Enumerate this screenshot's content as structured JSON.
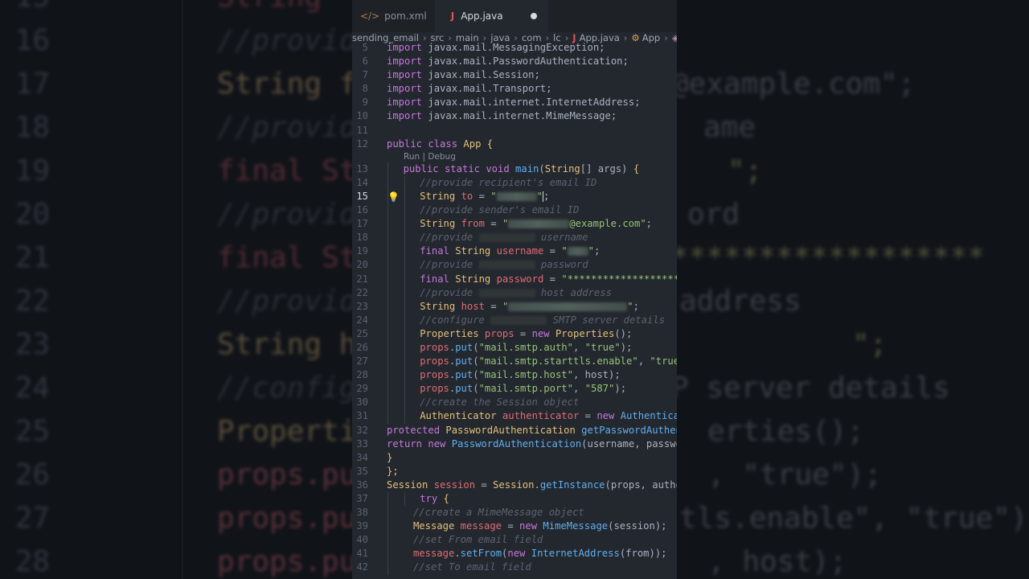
{
  "background": {
    "rows": [
      {
        "num": "15",
        "code": [
          {
            "t": "String",
            "c": "kw"
          }
        ]
      },
      {
        "num": "16",
        "code": [
          {
            "t": "//provid",
            "c": "cm"
          }
        ]
      },
      {
        "num": "17",
        "code": [
          {
            "t": "String f",
            "c": "ty"
          }
        ],
        "right": "@example.com\";"
      },
      {
        "num": "18",
        "code": [
          {
            "t": "//provid",
            "c": "cm"
          }
        ],
        "right": "ame"
      },
      {
        "num": "19",
        "code": [
          {
            "t": "final St",
            "c": "kw"
          }
        ],
        "right": "\";"
      },
      {
        "num": "20",
        "code": [
          {
            "t": "//provid",
            "c": "cm"
          }
        ],
        "right": "ord"
      },
      {
        "num": "21",
        "code": [
          {
            "t": "final St",
            "c": "kw"
          }
        ],
        "right": "******************"
      },
      {
        "num": "22",
        "code": [
          {
            "t": "//provid",
            "c": "cm"
          }
        ],
        "right": "address"
      },
      {
        "num": "23",
        "code": [
          {
            "t": "String h",
            "c": "ty"
          }
        ],
        "right": "\";"
      },
      {
        "num": "24",
        "code": [
          {
            "t": "//config",
            "c": "cm"
          }
        ],
        "right": "P server details"
      },
      {
        "num": "25",
        "code": [
          {
            "t": "Properti",
            "c": "ty"
          }
        ],
        "right": "erties();"
      },
      {
        "num": "26",
        "code": [
          {
            "t": "props.pu",
            "c": "vr"
          }
        ],
        "right": ", \"true\");"
      },
      {
        "num": "27",
        "code": [
          {
            "t": "props.pu",
            "c": "vr"
          }
        ],
        "right": "tls.enable\", \"true\")"
      },
      {
        "num": "28",
        "code": [
          {
            "t": "props.pu",
            "c": "vr"
          }
        ],
        "right": ", host);"
      }
    ]
  },
  "tabs": [
    {
      "label": "pom.xml",
      "icon": "xml-icon",
      "active": false
    },
    {
      "label": "App.java",
      "icon": "java-icon",
      "active": true,
      "modified": true
    }
  ],
  "breadcrumb": {
    "items": [
      "sending_email",
      "src",
      "main",
      "java",
      "com",
      "lc"
    ],
    "file": "App.java",
    "class": "App",
    "member": "m"
  },
  "codelens": "Run | Debug",
  "current_line": "15",
  "colors": {
    "editor_bg": "#23272e",
    "tab_bar_bg": "#1e2227",
    "keyword": "#c678dd",
    "type": "#e5c07b",
    "string": "#98c379",
    "function": "#61afef",
    "variable": "#e06c75",
    "comment": "#5c6370",
    "java_icon": "#e05252",
    "bulb": "#f0c94a"
  },
  "lines": [
    {
      "n": "5",
      "i": 0,
      "seg": [
        [
          "import ",
          "k"
        ],
        [
          "javax.mail.MessagingException;",
          "p"
        ]
      ]
    },
    {
      "n": "6",
      "i": 0,
      "seg": [
        [
          "import ",
          "k"
        ],
        [
          "javax.mail.PasswordAuthentication;",
          "p"
        ]
      ]
    },
    {
      "n": "7",
      "i": 0,
      "seg": [
        [
          "import ",
          "k"
        ],
        [
          "javax.mail.Session;",
          "p"
        ]
      ]
    },
    {
      "n": "8",
      "i": 0,
      "seg": [
        [
          "import ",
          "k"
        ],
        [
          "javax.mail.Transport;",
          "p"
        ]
      ]
    },
    {
      "n": "9",
      "i": 0,
      "seg": [
        [
          "import ",
          "k"
        ],
        [
          "javax.mail.internet.InternetAddress;",
          "p"
        ]
      ]
    },
    {
      "n": "10",
      "i": 0,
      "seg": [
        [
          "import ",
          "k"
        ],
        [
          "javax.mail.internet.MimeMessage;",
          "p"
        ]
      ]
    },
    {
      "n": "11",
      "i": 0,
      "seg": []
    },
    {
      "n": "12",
      "i": 0,
      "seg": [
        [
          "public ",
          "k"
        ],
        [
          "class ",
          "k"
        ],
        [
          "App",
          "t"
        ],
        [
          " {",
          "b"
        ]
      ]
    },
    {
      "n": "13",
      "i": 1,
      "lens": true,
      "seg": [
        [
          "public ",
          "k"
        ],
        [
          "static ",
          "k"
        ],
        [
          "void ",
          "k"
        ],
        [
          "main",
          "f"
        ],
        [
          "(",
          "p"
        ],
        [
          "String",
          "t"
        ],
        [
          "[] args) ",
          "p"
        ],
        [
          "{",
          "b"
        ]
      ]
    },
    {
      "n": "14",
      "i": 2,
      "seg": [
        [
          "//provide recipient's email ID",
          "c"
        ]
      ]
    },
    {
      "n": "15",
      "i": 2,
      "bulb": true,
      "seg": [
        [
          "String ",
          "t"
        ],
        [
          "to",
          "v"
        ],
        [
          " = ",
          "p"
        ],
        [
          "\"",
          "s"
        ],
        [
          "#blur:50",
          ""
        ],
        [
          "\"",
          "s"
        ],
        [
          "#cursor",
          ""
        ],
        [
          ";",
          "p"
        ]
      ]
    },
    {
      "n": "16",
      "i": 2,
      "seg": [
        [
          "//provide sender's email ID",
          "c"
        ]
      ]
    },
    {
      "n": "17",
      "i": 2,
      "seg": [
        [
          "String ",
          "t"
        ],
        [
          "from",
          "v"
        ],
        [
          " = ",
          "p"
        ],
        [
          "\"",
          "s"
        ],
        [
          "#blur:76",
          ""
        ],
        [
          "@example.com\"",
          "s"
        ],
        [
          ";",
          "p"
        ]
      ]
    },
    {
      "n": "18",
      "i": 2,
      "seg": [
        [
          "//provide ",
          "c"
        ],
        [
          "#dimblur:70",
          ""
        ],
        [
          " username",
          "c"
        ]
      ]
    },
    {
      "n": "19",
      "i": 2,
      "seg": [
        [
          "final ",
          "k"
        ],
        [
          "String ",
          "t"
        ],
        [
          "username",
          "v"
        ],
        [
          " = ",
          "p"
        ],
        [
          "\"",
          "s"
        ],
        [
          "#blur:26",
          ""
        ],
        [
          "\"",
          "s"
        ],
        [
          ";",
          "p"
        ]
      ]
    },
    {
      "n": "20",
      "i": 2,
      "seg": [
        [
          "//provide ",
          "c"
        ],
        [
          "#dimblur:70",
          ""
        ],
        [
          " password",
          "c"
        ]
      ]
    },
    {
      "n": "21",
      "i": 2,
      "seg": [
        [
          "final ",
          "k"
        ],
        [
          "String ",
          "t"
        ],
        [
          "password",
          "v"
        ],
        [
          " = ",
          "p"
        ],
        [
          "\"**********************",
          "s"
        ]
      ]
    },
    {
      "n": "22",
      "i": 2,
      "seg": [
        [
          "//provide ",
          "c"
        ],
        [
          "#dimblur:70",
          ""
        ],
        [
          " host address",
          "c"
        ]
      ]
    },
    {
      "n": "23",
      "i": 2,
      "seg": [
        [
          "String ",
          "t"
        ],
        [
          "host",
          "v"
        ],
        [
          " = ",
          "p"
        ],
        [
          "\"",
          "s"
        ],
        [
          "#blur:148",
          ""
        ],
        [
          "\"",
          "s"
        ],
        [
          ";",
          "p"
        ]
      ]
    },
    {
      "n": "24",
      "i": 2,
      "seg": [
        [
          "//configure ",
          "c"
        ],
        [
          "#dimblur:70",
          ""
        ],
        [
          " SMTP server details",
          "c"
        ]
      ]
    },
    {
      "n": "25",
      "i": 2,
      "seg": [
        [
          "Properties ",
          "t"
        ],
        [
          "props",
          "v"
        ],
        [
          " = ",
          "p"
        ],
        [
          "new ",
          "k"
        ],
        [
          "Properties",
          "t"
        ],
        [
          "();",
          "p"
        ]
      ]
    },
    {
      "n": "26",
      "i": 2,
      "seg": [
        [
          "props",
          "v"
        ],
        [
          ".",
          "p"
        ],
        [
          "put",
          "f"
        ],
        [
          "(",
          "p"
        ],
        [
          "\"mail.smtp.auth\"",
          "s"
        ],
        [
          ", ",
          "p"
        ],
        [
          "\"true\"",
          "s"
        ],
        [
          ");",
          "p"
        ]
      ]
    },
    {
      "n": "27",
      "i": 2,
      "seg": [
        [
          "props",
          "v"
        ],
        [
          ".",
          "p"
        ],
        [
          "put",
          "f"
        ],
        [
          "(",
          "p"
        ],
        [
          "\"mail.smtp.starttls.enable\"",
          "s"
        ],
        [
          ", ",
          "p"
        ],
        [
          "\"true\"",
          "s"
        ],
        [
          ")",
          "p"
        ]
      ]
    },
    {
      "n": "28",
      "i": 2,
      "seg": [
        [
          "props",
          "v"
        ],
        [
          ".",
          "p"
        ],
        [
          "put",
          "f"
        ],
        [
          "(",
          "p"
        ],
        [
          "\"mail.smtp.host\"",
          "s"
        ],
        [
          ", host);",
          "p"
        ]
      ]
    },
    {
      "n": "29",
      "i": 2,
      "seg": [
        [
          "props",
          "v"
        ],
        [
          ".",
          "p"
        ],
        [
          "put",
          "f"
        ],
        [
          "(",
          "p"
        ],
        [
          "\"mail.smtp.port\"",
          "s"
        ],
        [
          ", ",
          "p"
        ],
        [
          "\"587\"",
          "s"
        ],
        [
          ");",
          "p"
        ]
      ]
    },
    {
      "n": "30",
      "i": 2,
      "seg": [
        [
          "//create the Session object",
          "c"
        ]
      ]
    },
    {
      "n": "31",
      "i": 2,
      "seg": [
        [
          "Authenticator ",
          "t"
        ],
        [
          "authenticator",
          "v"
        ],
        [
          " = ",
          "p"
        ],
        [
          "new ",
          "k"
        ],
        [
          "Authenticator",
          "f"
        ]
      ]
    },
    {
      "n": "32",
      "i": 0,
      "seg": [
        [
          "protected ",
          "k"
        ],
        [
          "PasswordAuthentication ",
          "t"
        ],
        [
          "getPasswordAuthentic",
          "f"
        ]
      ]
    },
    {
      "n": "33",
      "i": 0,
      "seg": [
        [
          "return ",
          "k"
        ],
        [
          "new ",
          "k"
        ],
        [
          "PasswordAuthentication",
          "f"
        ],
        [
          "(username, password",
          "p"
        ]
      ]
    },
    {
      "n": "34",
      "i": 0,
      "seg": [
        [
          "}",
          "b"
        ]
      ]
    },
    {
      "n": "35",
      "i": 0,
      "seg": [
        [
          "};",
          "b"
        ]
      ]
    },
    {
      "n": "36",
      "i": 0,
      "seg": [
        [
          "Session ",
          "t"
        ],
        [
          "session",
          "v"
        ],
        [
          " = ",
          "p"
        ],
        [
          "Session",
          "t"
        ],
        [
          ".",
          "p"
        ],
        [
          "getInstance",
          "f"
        ],
        [
          "(props, authent",
          "p"
        ]
      ]
    },
    {
      "n": "37",
      "i": 2,
      "seg": [
        [
          "try ",
          "k"
        ],
        [
          "{",
          "b"
        ]
      ]
    },
    {
      "n": "38",
      "i": 1.6,
      "seg": [
        [
          "//create a MimeMessage object",
          "c"
        ]
      ]
    },
    {
      "n": "39",
      "i": 1.6,
      "seg": [
        [
          "Message ",
          "t"
        ],
        [
          "message",
          "v"
        ],
        [
          " = ",
          "p"
        ],
        [
          "new ",
          "k"
        ],
        [
          "MimeMessage",
          "f"
        ],
        [
          "(session);",
          "p"
        ]
      ]
    },
    {
      "n": "40",
      "i": 1.6,
      "seg": [
        [
          "//set From email field",
          "c"
        ]
      ]
    },
    {
      "n": "41",
      "i": 1.6,
      "seg": [
        [
          "message",
          "v"
        ],
        [
          ".",
          "p"
        ],
        [
          "setFrom",
          "f"
        ],
        [
          "(",
          "p"
        ],
        [
          "new ",
          "k"
        ],
        [
          "InternetAddress",
          "f"
        ],
        [
          "(from));",
          "p"
        ]
      ]
    },
    {
      "n": "42",
      "i": 1.6,
      "seg": [
        [
          "//set To email field",
          "c"
        ]
      ]
    }
  ]
}
